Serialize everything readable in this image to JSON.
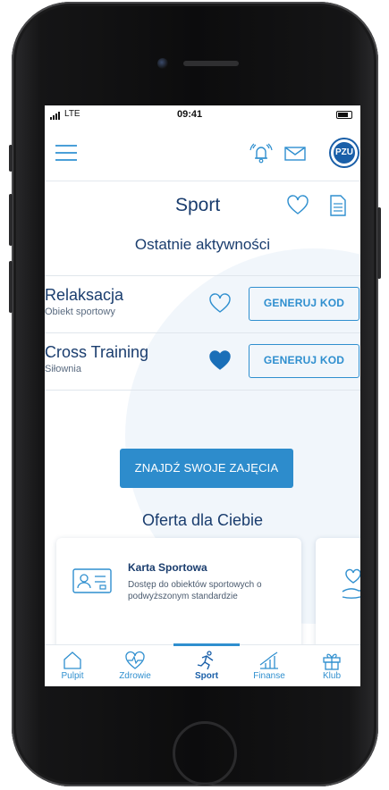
{
  "status_bar": {
    "carrier": "LTE",
    "time": "09:41"
  },
  "header": {
    "logo_text": "PZU"
  },
  "page": {
    "title": "Sport",
    "recent_heading": "Ostatnie aktywności"
  },
  "activities": [
    {
      "title": "Relaksacja",
      "subtitle": "Obiekt sportowy",
      "favorite": false,
      "button": "GENERUJ KOD"
    },
    {
      "title": "Cross Training",
      "subtitle": "Siłownia",
      "favorite": true,
      "button": "GENERUJ KOD"
    }
  ],
  "find_button": "ZNAJDŹ SWOJE ZAJĘCIA",
  "offer": {
    "heading": "Oferta dla Ciebie",
    "cards": [
      {
        "title": "Karta Sportowa",
        "description": "Dostęp do obiektów sportowych o podwyższonym standardzie",
        "icon": "id-card-icon"
      },
      {
        "title": "",
        "description": "",
        "icon": "heart-hand-icon"
      }
    ]
  },
  "tabs": [
    {
      "label": "Pulpit",
      "icon": "home-icon",
      "active": false
    },
    {
      "label": "Zdrowie",
      "icon": "heart-pulse-icon",
      "active": false
    },
    {
      "label": "Sport",
      "icon": "runner-icon",
      "active": true
    },
    {
      "label": "Finanse",
      "icon": "chart-icon",
      "active": false
    },
    {
      "label": "Klub",
      "icon": "gift-icon",
      "active": false
    }
  ],
  "colors": {
    "accent": "#2f8fcf",
    "primary_button": "#2d8ccc",
    "text_dark": "#1a3d6e",
    "logo": "#1a5fa8"
  }
}
